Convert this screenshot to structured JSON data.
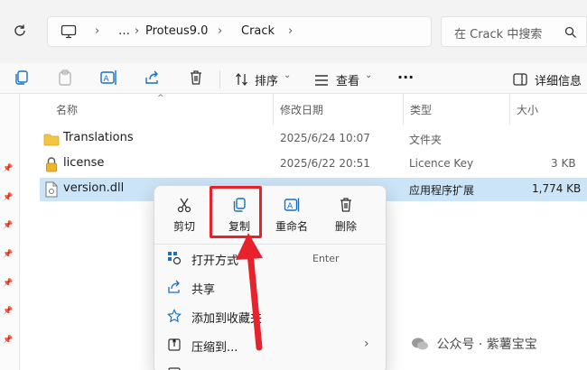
{
  "address": {
    "breadcrumbs": [
      "…",
      "Proteus9.0",
      "Crack"
    ],
    "search_placeholder": "在 Crack 中搜索"
  },
  "toolbar": {
    "sort_label": "排序",
    "view_label": "查看",
    "more_label": "···",
    "details_label": "详细信息"
  },
  "columns": {
    "name": "名称",
    "modified": "修改日期",
    "type": "类型",
    "size": "大小"
  },
  "files": [
    {
      "name": "Translations",
      "modified": "2025/6/24 10:07",
      "type": "文件夹",
      "size": "",
      "icon": "folder-icon"
    },
    {
      "name": "license",
      "modified": "2025/6/22 20:51",
      "type": "Licence Key",
      "size": "3 KB",
      "icon": "lock-file-icon"
    },
    {
      "name": "version.dll",
      "modified": "",
      "type": "应用程序扩展",
      "size": "1,774 KB",
      "icon": "dll-file-icon"
    }
  ],
  "context_menu": {
    "quick_actions": [
      "剪切",
      "复制",
      "重命名",
      "删除"
    ],
    "items": [
      {
        "label": "打开方式",
        "shortcut": "Enter",
        "icon": "open-with-icon"
      },
      {
        "label": "共享",
        "shortcut": "",
        "icon": "share-icon"
      },
      {
        "label": "添加到收藏夹",
        "shortcut": "",
        "icon": "star-icon"
      },
      {
        "label": "压缩到...",
        "shortcut": "",
        "icon": "zip-icon"
      }
    ]
  },
  "watermark": "公众号 · 紫薯宝宝",
  "colors": {
    "selection": "#cce4f7",
    "highlight": "#e8222d",
    "folder": "#f4c542"
  }
}
